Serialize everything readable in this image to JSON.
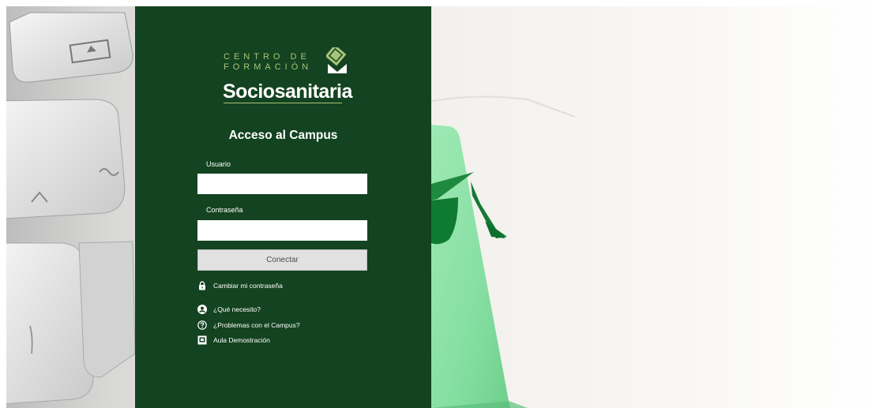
{
  "logo": {
    "line1": "CENTRO DE",
    "line2": "FORMACIÓN",
    "name": "Sociosanitaria"
  },
  "login": {
    "title": "Acceso al Campus",
    "username_label": "Usuario",
    "username_value": "",
    "password_label": "Contraseña",
    "password_value": "",
    "submit_label": "Conectar"
  },
  "links": [
    {
      "icon": "lock-icon",
      "label": "Cambiar mi contraseña"
    },
    {
      "icon": "user-circle-icon",
      "label": "¿Qué necesito?"
    },
    {
      "icon": "question-circle-icon",
      "label": "¿Problemas con el Campus?"
    },
    {
      "icon": "monitor-icon",
      "label": "Aula Demostración"
    }
  ],
  "colors": {
    "panel": "#134320",
    "logo_accent": "#a9c47a",
    "green_key": "#8ee3a9"
  }
}
